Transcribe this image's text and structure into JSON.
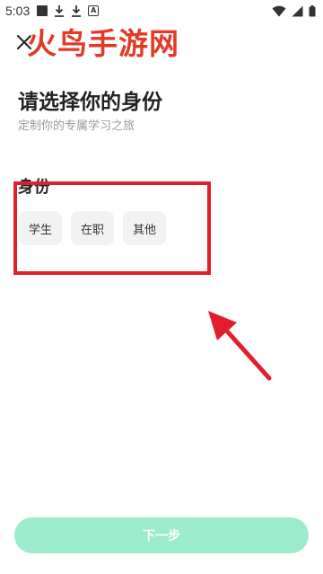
{
  "status_bar": {
    "time": "5:03",
    "notification_box_label": "A",
    "icons": [
      "square-notification-icon",
      "download-icon",
      "download-icon",
      "a-box-icon",
      "wifi-icon",
      "signal-icon",
      "battery-icon"
    ]
  },
  "watermark": {
    "text": "火鸟手游网"
  },
  "header": {
    "close_icon": "close-icon",
    "title": "请选择你的身份",
    "subtitle": "定制你的专属学习之旅"
  },
  "identity": {
    "label": "身份",
    "options": [
      {
        "label": "学生"
      },
      {
        "label": "在职"
      },
      {
        "label": "其他"
      }
    ]
  },
  "footer": {
    "next_label": "下一步"
  },
  "colors": {
    "annotation_red": "#e21e2e",
    "watermark_red": "#e23a26",
    "button_green": "#9cebcc",
    "chip_bg": "#f2f2f2"
  }
}
